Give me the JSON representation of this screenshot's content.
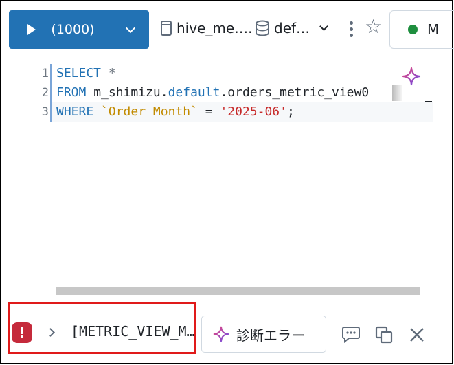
{
  "toolbar": {
    "run_label": "(1000)",
    "catalog": "hive_me….",
    "schema": "def…",
    "compute_label": "M"
  },
  "editor": {
    "line_numbers": [
      "1",
      "2",
      "3"
    ],
    "line1": {
      "kw": "SELECT",
      "rest": " *"
    },
    "line2": {
      "kw": "FROM",
      "a": " m_shimizu.",
      "b": "default",
      "c": ".orders_metric_view0"
    },
    "line3": {
      "kw": "WHERE",
      "a": " ",
      "ident": "`Order Month`",
      "eq": " = ",
      "str": "'2025-06'",
      "end": ";"
    }
  },
  "error_bar": {
    "message": "[METRIC_VIEW_M…",
    "diagnose_label": "診断エラー"
  },
  "colors": {
    "run_button": "#2272b4",
    "keyword": "#2272b4",
    "string": "#c72a2a",
    "identifier": "#c28b00",
    "error": "#c52a3b",
    "highlight_box": "#e01a1a"
  },
  "icons": [
    "play-icon",
    "chevron-down-icon",
    "file-icon",
    "database-icon",
    "kebab-icon",
    "star-icon",
    "status-dot-icon",
    "sparkle-icon",
    "error-icon",
    "chevron-right-icon",
    "chat-icon",
    "copy-icon",
    "close-icon"
  ]
}
